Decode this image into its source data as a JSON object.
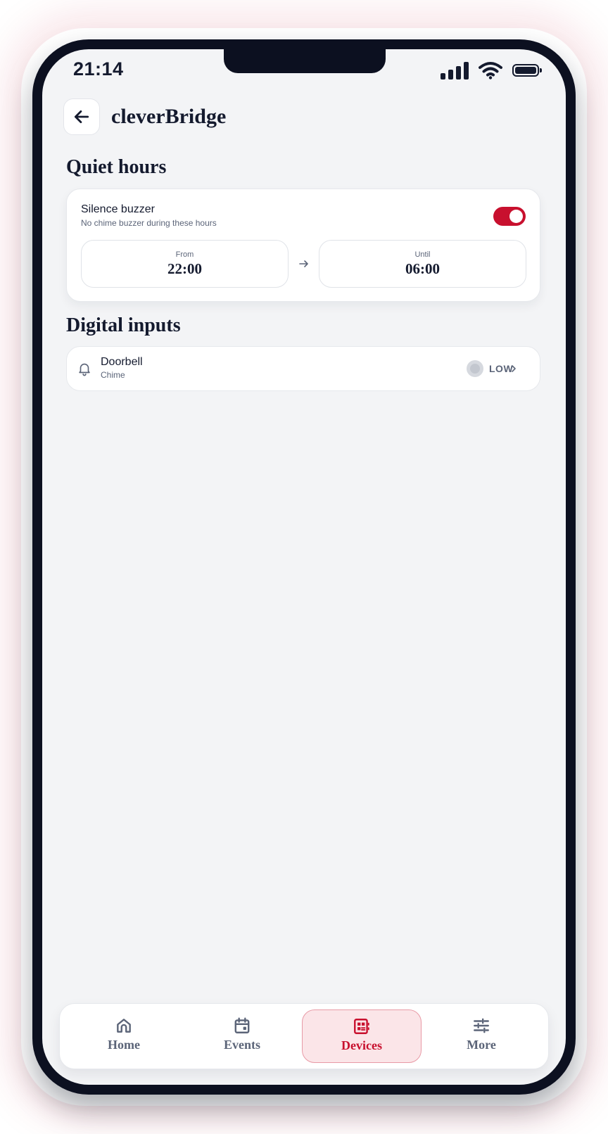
{
  "status_bar": {
    "time": "21:14"
  },
  "header": {
    "title": "cleverBridge"
  },
  "quiet_hours": {
    "title": "Quiet hours",
    "silence_label": "Silence buzzer",
    "silence_sub": "No chime buzzer during these hours",
    "enabled": true,
    "from_label": "From",
    "from_value": "22:00",
    "until_label": "Until",
    "until_value": "06:00"
  },
  "digital_inputs": {
    "title": "Digital inputs",
    "items": [
      {
        "name": "Doorbell",
        "type": "Chime",
        "state": "LOW",
        "icon": "bell-icon"
      }
    ]
  },
  "tabs": [
    {
      "label": "Home",
      "icon": "home-icon",
      "active": false
    },
    {
      "label": "Events",
      "icon": "calendar-icon",
      "active": false
    },
    {
      "label": "Devices",
      "icon": "devices-icon",
      "active": true
    },
    {
      "label": "More",
      "icon": "sliders-icon",
      "active": false
    }
  ],
  "colors": {
    "accent": "#c8102e",
    "text": "#141a2e",
    "muted": "#5b6478",
    "background": "#f3f4f6"
  }
}
